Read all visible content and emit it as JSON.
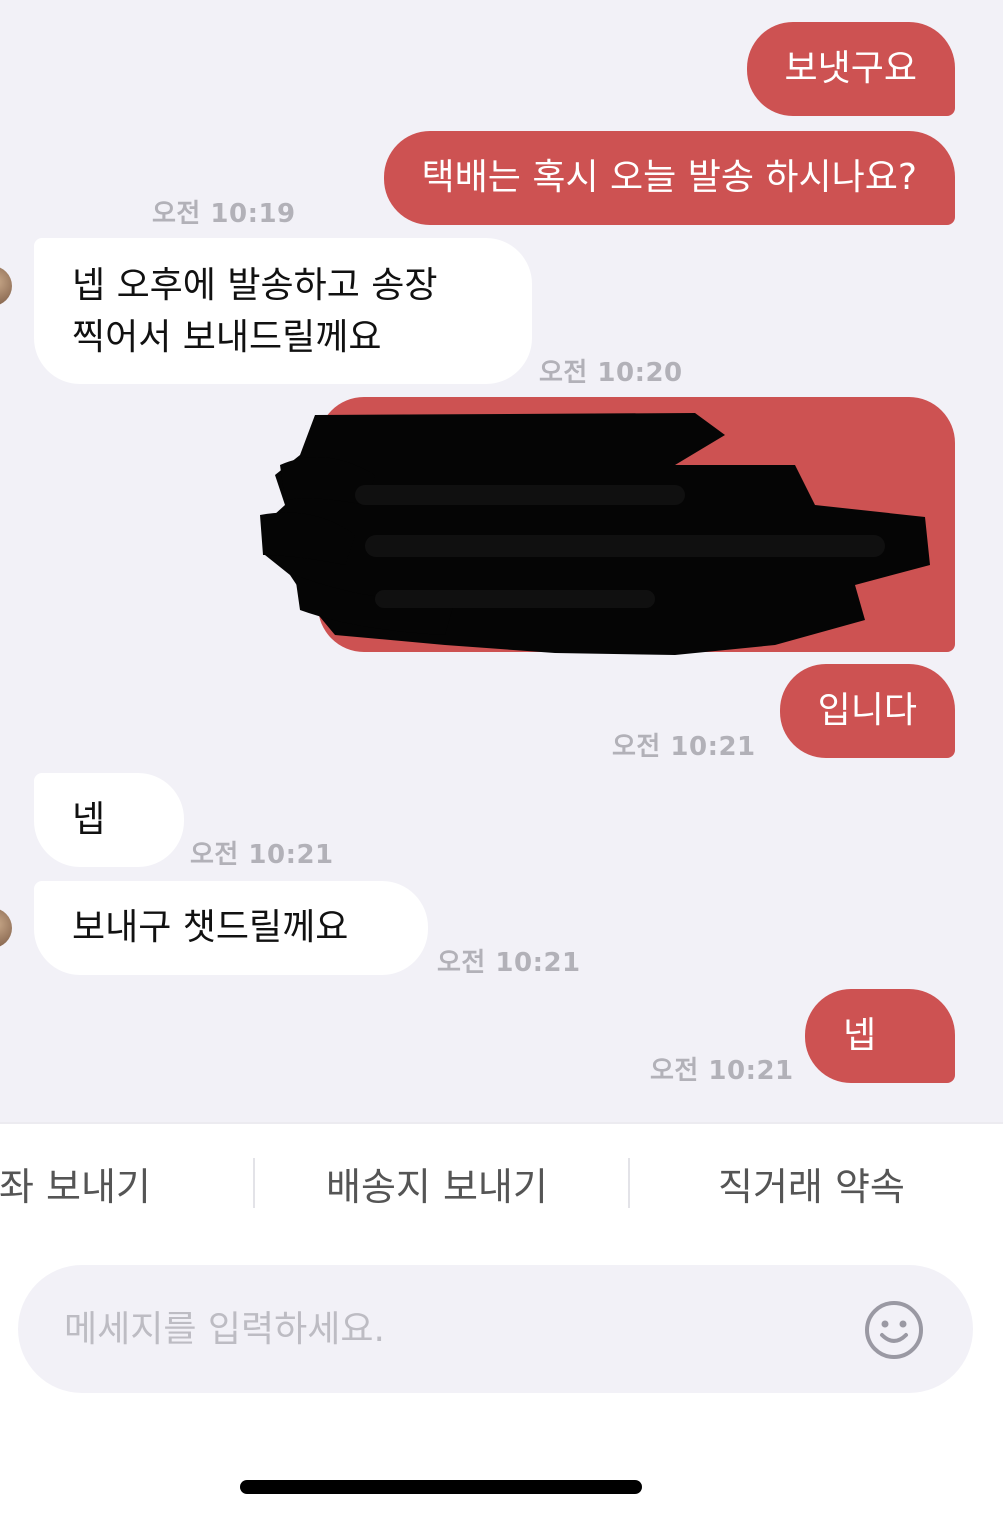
{
  "messages": [
    {
      "id": "m1",
      "side": "out",
      "text": "보냇구요",
      "time": ""
    },
    {
      "id": "m2",
      "side": "out",
      "text": "택배는 혹시 오늘 발송 하시나요?",
      "time": "오전 10:19"
    },
    {
      "id": "m3",
      "side": "in",
      "line1": "넵 오후에 발송하고 송장",
      "line2": "찍어서 보내드릴께요",
      "time": "오전 10:20"
    },
    {
      "id": "m4",
      "side": "out",
      "text": "입니다",
      "time": "오전 10:21"
    },
    {
      "id": "m5",
      "side": "in",
      "text": "넵",
      "time": "오전 10:21"
    },
    {
      "id": "m6",
      "side": "in",
      "text": "보내구 챗드릴께요",
      "time": "오전 10:21"
    },
    {
      "id": "m7",
      "side": "out",
      "text": "넵",
      "time": "오전 10:21"
    }
  ],
  "quick_actions": {
    "account": "계좌 보내기",
    "shipping": "배송지 보내기",
    "meetup": "직거래 약속"
  },
  "composer": {
    "placeholder": "메세지를 입력하세요.",
    "emoji_icon": "smiley-icon"
  },
  "colors": {
    "outgoing_bubble": "#cd5252",
    "incoming_bubble": "#ffffff",
    "chat_background": "#f2f1f7"
  }
}
